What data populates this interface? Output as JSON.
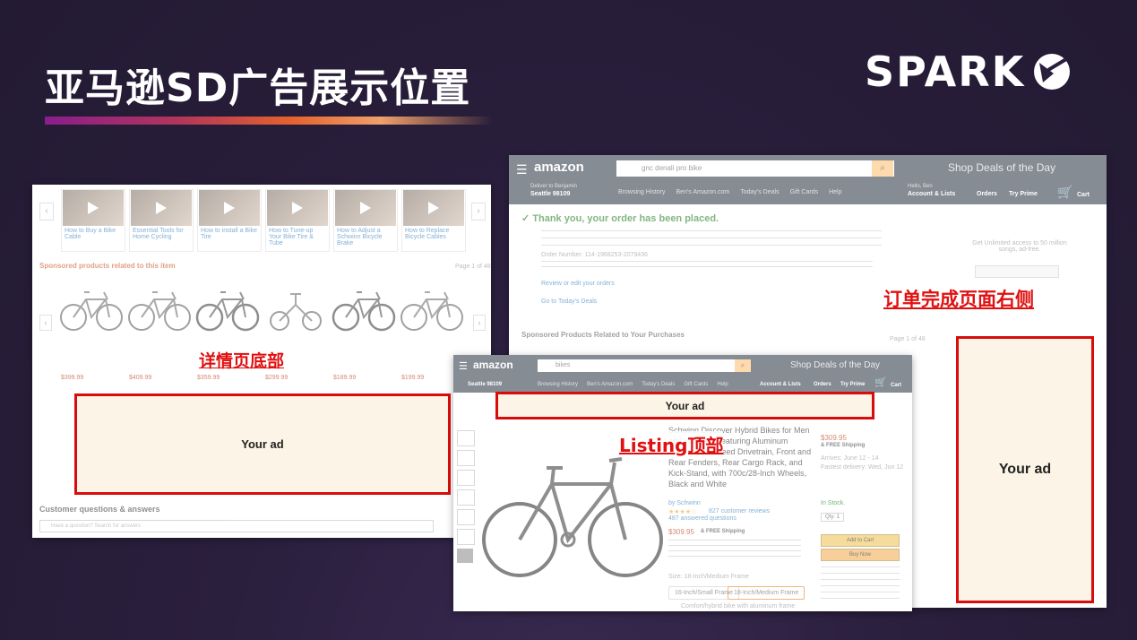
{
  "slide": {
    "title": "亚马逊SD广告展示位置",
    "logo_text": "SPARK",
    "accent_gradient": [
      "#8a1e8c",
      "#e3622e"
    ],
    "background": "#2a1f3d"
  },
  "labels": {
    "detail_bottom": "详情页底部",
    "listing_top": "Listing顶部",
    "order_right": "订单完成页面右侧"
  },
  "ads": {
    "detail_ad": "Your ad",
    "listing_ad": "Your ad",
    "order_ad": "Your ad"
  },
  "detail_page": {
    "sponsored_heading": "Sponsored products related to this item",
    "page_count": "Page 1 of 48",
    "customer_qa": "Customer questions & answers",
    "qa_placeholder": "Have a question? Search for answers",
    "video_titles": [
      "How to Buy a Bike Cable",
      "Essential Tools for Home Cycling",
      "How to install a Bike Tire",
      "How to Tune-up Your Bike Tire & Tube",
      "How to Adjust a Schwinn Bicycle Brake",
      "How to Replace Bicycle Cables"
    ],
    "product_prices": [
      "$399.99",
      "$409.99",
      "$359.99",
      "$299.99",
      "$189.99",
      "$199.99"
    ]
  },
  "order_page": {
    "brand": "amazon",
    "search_value": "gnc denali pro bike",
    "promo": "Shop Deals of the Day",
    "deliver_to": "Deliver to Benjamin",
    "deliver_city": "Seattle 98109",
    "nav_items": [
      "Browsing History",
      "Ben's Amazon.com",
      "Today's Deals",
      "Gift Cards",
      "Help"
    ],
    "account_greeting": "Hello, Ben",
    "account_label": "Account & Lists",
    "orders": "Orders",
    "try_prime": "Try Prime",
    "cart": "Cart",
    "confirmation": "Thank you, your order has been placed.",
    "order_number": "Order Number: 114-1968253-2079436",
    "unlimited_promo": "Get Unlimited access to 50 million songs, ad-free.",
    "review_link": "Review or edit your orders",
    "shop_link": "Go to Today's Deals",
    "related_heading": "Sponsored Products Related to Your Purchases",
    "related_page": "Page 1 of 48"
  },
  "listing_page": {
    "brand": "amazon",
    "search_value": "bikes",
    "promo": "Shop Deals of the Day",
    "deliver_city": "Seattle 98109",
    "nav_items": [
      "Browsing History",
      "Ben's Amazon.com",
      "Today's Deals",
      "Gift Cards",
      "Help"
    ],
    "account_label": "Account & Lists",
    "orders": "Orders",
    "try_prime": "Try Prime",
    "cart": "Cart",
    "product_title": "Schwinn Discover Hybrid Bikes for Men and Women, Featuring Aluminum Frames, 21-Speed Drivetrain, Front and Rear Fenders, Rear Cargo Rack, and Kick-Stand, with 700c/28-Inch Wheels, Black and White",
    "byline": "by Schwinn",
    "reviews": "827 customer reviews",
    "answered": "487 answered questions",
    "price": "$309.95",
    "shipping": "& FREE Shipping",
    "side_price": "$309.95",
    "in_stock": "In Stock.",
    "qty": "Qty: 1",
    "add_to_cart": "Add to Cart",
    "buy_now": "Buy Now",
    "arrives": "Arrives: June 12 - 14",
    "fastest": "Fastest delivery: Wed, Jun 12",
    "size_label": "Size: 18-Inch/Medium Frame",
    "sizes": [
      "16-Inch/Small Frame",
      "18-Inch/Medium Frame"
    ],
    "feature": "Comfort/hybrid bike with aluminum frame"
  }
}
